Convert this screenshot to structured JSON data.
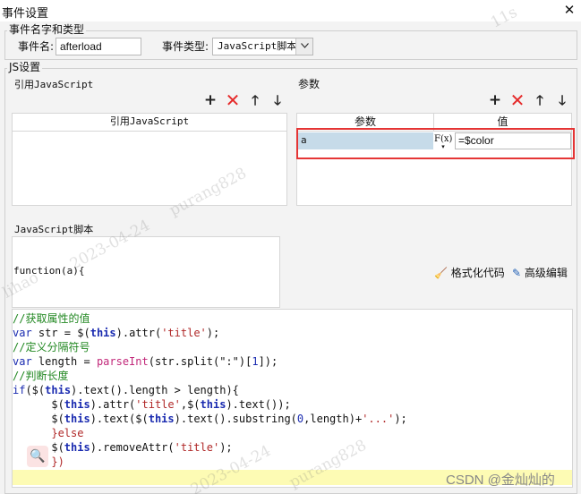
{
  "window": {
    "title": "事件设置",
    "close_symbol": "✕"
  },
  "event_group": {
    "label": "事件名字和类型",
    "name_label": "事件名:",
    "name_value": "afterload",
    "type_label": "事件类型:",
    "type_value": "JavaScript脚本"
  },
  "js_group": {
    "label": "JS设置"
  },
  "references": {
    "section_label": "引用JavaScript",
    "column_header": "引用JavaScript"
  },
  "params": {
    "section_label": "参数",
    "columns": [
      "参数",
      "值"
    ],
    "rows": [
      {
        "name": "a",
        "fx": "F(x)",
        "value": "=$color"
      }
    ]
  },
  "script": {
    "section_label": "JavaScript脚本",
    "signature": "function(a){",
    "format_button": "格式化代码",
    "advanced_button": "高级编辑",
    "lines": [
      [
        {
          "t": "//获取属性的值",
          "c": "cm"
        }
      ],
      [
        {
          "t": "var",
          "c": "kwn"
        },
        {
          "t": " str = $(",
          "c": ""
        },
        {
          "t": "this",
          "c": "kw"
        },
        {
          "t": ").attr(",
          "c": ""
        },
        {
          "t": "'title'",
          "c": "str"
        },
        {
          "t": ");",
          "c": ""
        }
      ],
      [
        {
          "t": "//定义分隔符号",
          "c": "cm"
        }
      ],
      [
        {
          "t": "var",
          "c": "kwn"
        },
        {
          "t": " length = ",
          "c": ""
        },
        {
          "t": "parseInt",
          "c": "fn"
        },
        {
          "t": "(str.split(\":\")[",
          "c": ""
        },
        {
          "t": "1",
          "c": "num"
        },
        {
          "t": "]);",
          "c": ""
        }
      ],
      [
        {
          "t": "//判断长度",
          "c": "cm"
        }
      ],
      [
        {
          "t": "if",
          "c": "kwn"
        },
        {
          "t": "($(",
          "c": ""
        },
        {
          "t": "this",
          "c": "kw"
        },
        {
          "t": ").text().length > length){",
          "c": ""
        }
      ],
      [
        {
          "t": "      $(",
          "c": ""
        },
        {
          "t": "this",
          "c": "kw"
        },
        {
          "t": ").attr(",
          "c": ""
        },
        {
          "t": "'title'",
          "c": "str"
        },
        {
          "t": ",$(",
          "c": ""
        },
        {
          "t": "this",
          "c": "kw"
        },
        {
          "t": ").text());",
          "c": ""
        }
      ],
      [
        {
          "t": "      $(",
          "c": ""
        },
        {
          "t": "this",
          "c": "kw"
        },
        {
          "t": ").text($(",
          "c": ""
        },
        {
          "t": "this",
          "c": "kw"
        },
        {
          "t": ").text().substring(",
          "c": ""
        },
        {
          "t": "0",
          "c": "num"
        },
        {
          "t": ",length)+",
          "c": ""
        },
        {
          "t": "'...'",
          "c": "str"
        },
        {
          "t": ");",
          "c": ""
        }
      ],
      [
        {
          "t": "      }else",
          "c": "str"
        }
      ],
      [
        {
          "t": "      $(",
          "c": ""
        },
        {
          "t": "this",
          "c": "kw"
        },
        {
          "t": ").removeAttr(",
          "c": ""
        },
        {
          "t": "'title'",
          "c": "str"
        },
        {
          "t": ");",
          "c": ""
        }
      ],
      [
        {
          "t": "      })",
          "c": "str"
        }
      ]
    ]
  },
  "watermarks": [
    "purang828",
    "2023-04-24",
    "11s",
    "lihao"
  ],
  "csdn_label": "CSDN @金灿灿的",
  "colors": {
    "accent_red": "#e53535",
    "param_row": "#c6dbe9",
    "current_line": "#fdfbb4"
  }
}
